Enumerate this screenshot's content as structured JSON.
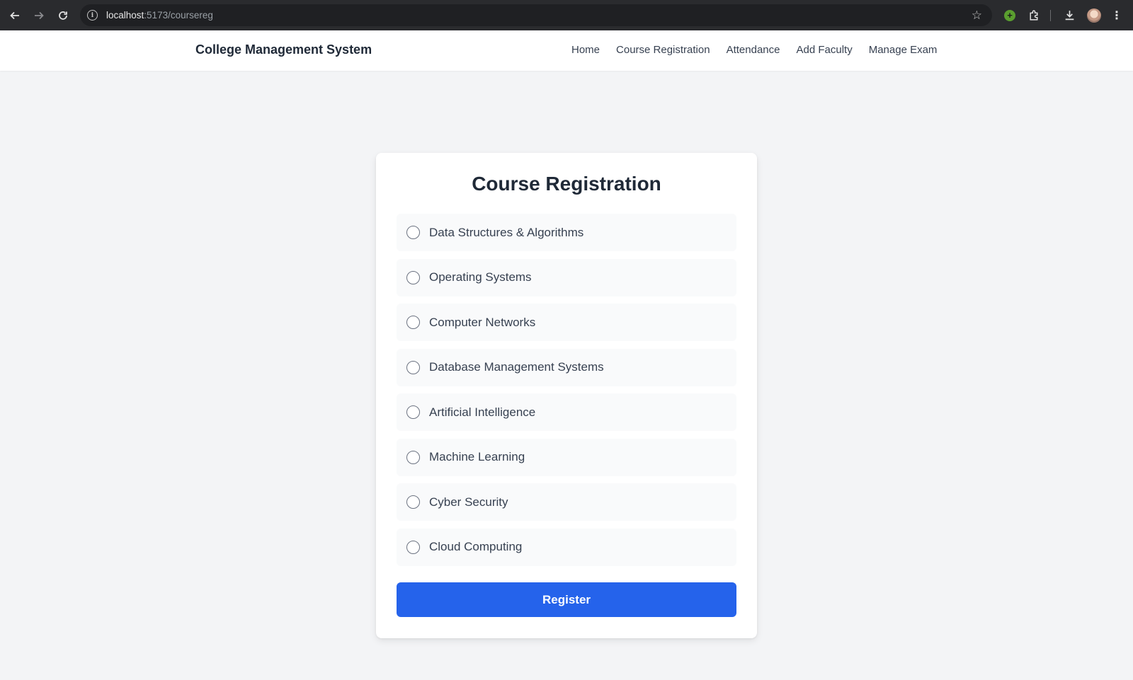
{
  "browser": {
    "url_host": "localhost",
    "url_path": ":5173/coursereg",
    "icons": [
      "back-icon",
      "forward-icon",
      "reload-icon",
      "site-info-icon",
      "bookmark-star-icon",
      "extension-green-icon",
      "extensions-puzzle-icon",
      "download-icon",
      "profile-avatar",
      "more-menu-icon"
    ]
  },
  "navbar": {
    "brand": "College Management System",
    "links": [
      {
        "label": "Home"
      },
      {
        "label": "Course Registration"
      },
      {
        "label": "Attendance"
      },
      {
        "label": "Add Faculty"
      },
      {
        "label": "Manage Exam"
      }
    ]
  },
  "card": {
    "title": "Course Registration",
    "courses": [
      {
        "label": "Data Structures & Algorithms",
        "selected": false
      },
      {
        "label": "Operating Systems",
        "selected": false
      },
      {
        "label": "Computer Networks",
        "selected": false
      },
      {
        "label": "Database Management Systems",
        "selected": false
      },
      {
        "label": "Artificial Intelligence",
        "selected": false
      },
      {
        "label": "Machine Learning",
        "selected": false
      },
      {
        "label": "Cyber Security",
        "selected": false
      },
      {
        "label": "Cloud Computing",
        "selected": false
      }
    ],
    "register_label": "Register"
  },
  "colors": {
    "accent": "#2563eb",
    "page_background": "#f3f4f6",
    "chrome_dark": "#2a2b2e"
  }
}
